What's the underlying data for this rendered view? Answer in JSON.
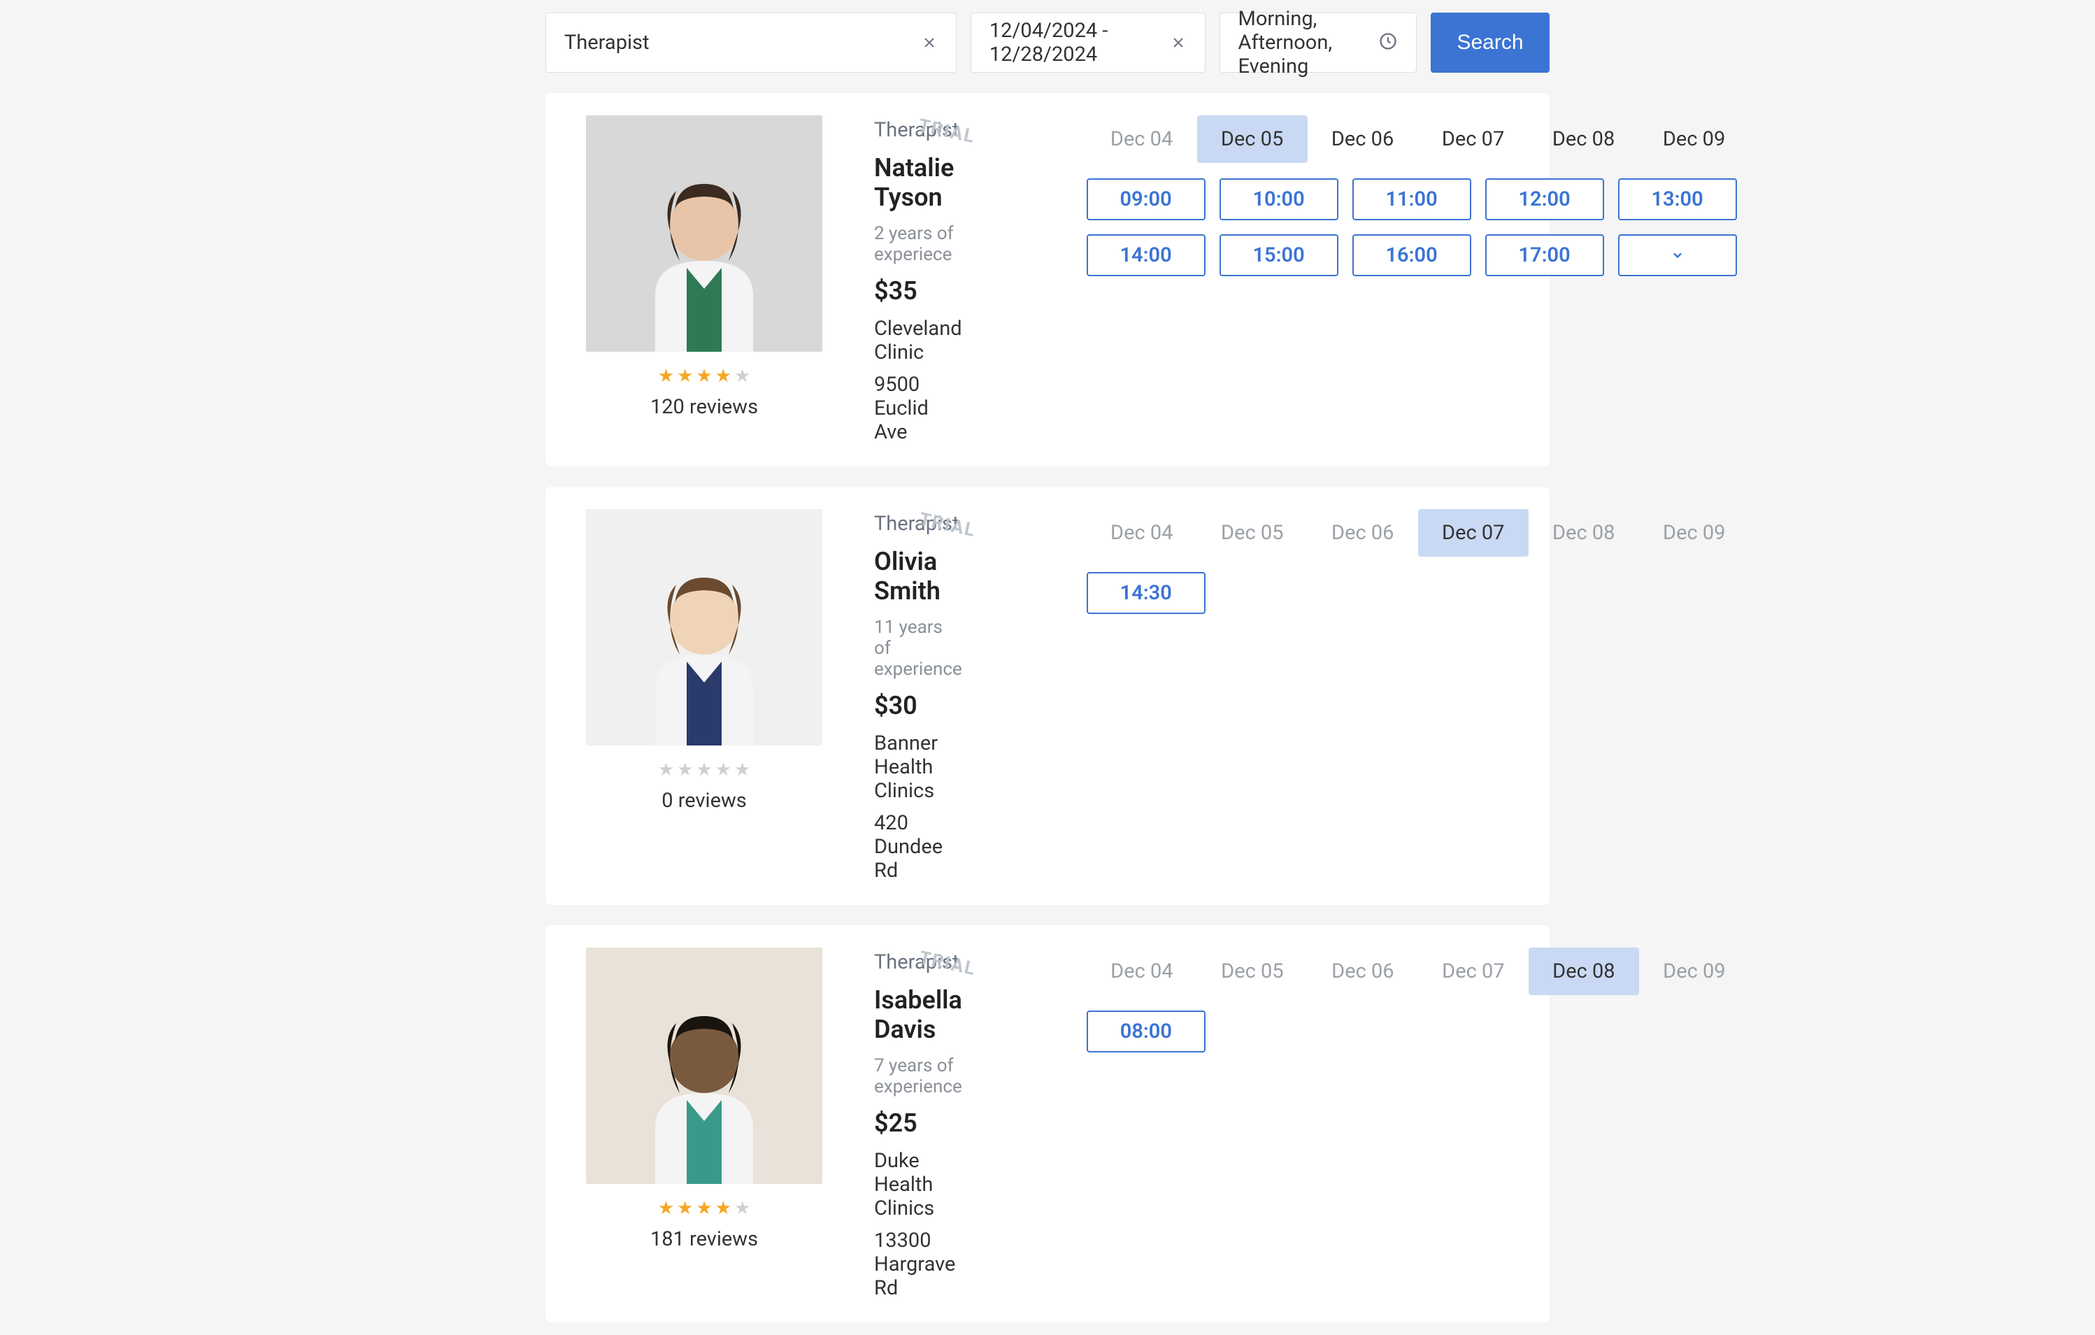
{
  "search": {
    "specialty_value": "Therapist",
    "daterange_value": "12/04/2024 - 12/28/2024",
    "timeofday_value": "Morning, Afternoon, Evening",
    "search_label": "Search"
  },
  "dates": [
    "Dec 04",
    "Dec 05",
    "Dec 06",
    "Dec 07",
    "Dec 08",
    "Dec 09"
  ],
  "doctors": [
    {
      "specialty": "Therapist",
      "trial": "TRIAL",
      "name": "Natalie Tyson",
      "experience": "2 years of experiece",
      "price": "$35",
      "clinic": "Cleveland Clinic",
      "address": "9500 Euclid Ave",
      "rating": 4,
      "reviews": "120 reviews",
      "active_date_idx": 1,
      "date_avail": [
        false,
        true,
        true,
        true,
        true,
        true
      ],
      "times": [
        "09:00",
        "10:00",
        "11:00",
        "12:00",
        "13:00",
        "14:00",
        "15:00",
        "16:00",
        "17:00"
      ],
      "has_expand": true,
      "photo_bg": "#d8d8d8",
      "coat": "#f4f4f4",
      "skin": "#e8c5a8",
      "hair": "#3a2a1f",
      "shirt": "#2f7a54"
    },
    {
      "specialty": "Therapist",
      "trial": "TRIAL",
      "name": "Olivia Smith",
      "experience": "11 years of experience",
      "price": "$30",
      "clinic": "Banner Health Clinics",
      "address": "420 Dundee Rd",
      "rating": 0,
      "reviews": "0 reviews",
      "active_date_idx": 3,
      "date_avail": [
        false,
        false,
        false,
        true,
        false,
        false
      ],
      "times": [
        "14:30"
      ],
      "has_expand": false,
      "photo_bg": "#f0f0f0",
      "coat": "#f4f4f4",
      "skin": "#f0d4b8",
      "hair": "#6b4a2f",
      "shirt": "#2a3a6b"
    },
    {
      "specialty": "Therapist",
      "trial": "TRIAL",
      "name": "Isabella Davis",
      "experience": "7 years of experience",
      "price": "$25",
      "clinic": "Duke Health Clinics",
      "address": "13300 Hargrave Rd",
      "rating": 4,
      "reviews": "181 reviews",
      "active_date_idx": 4,
      "date_avail": [
        false,
        false,
        false,
        false,
        true,
        false
      ],
      "times": [
        "08:00"
      ],
      "has_expand": false,
      "photo_bg": "#e8e2d8",
      "coat": "#f4f4f4",
      "skin": "#7a5a3f",
      "hair": "#1a1410",
      "shirt": "#3a9a8a"
    }
  ]
}
